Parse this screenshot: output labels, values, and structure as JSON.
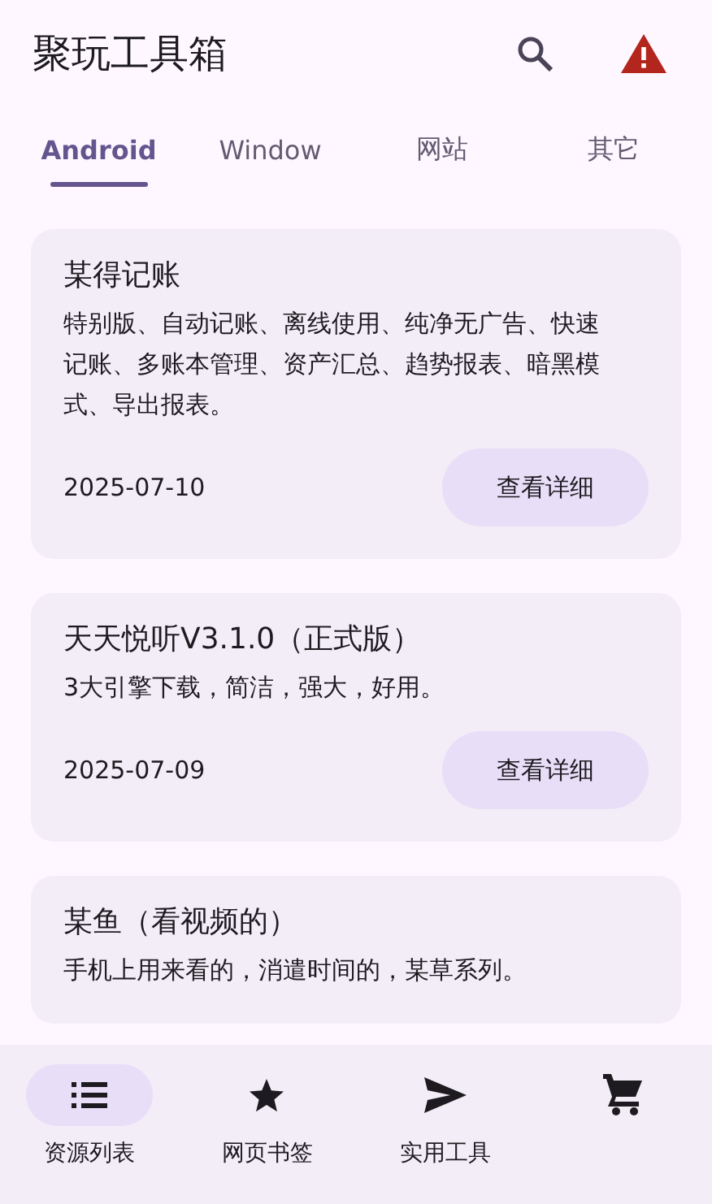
{
  "app_bar": {
    "title": "聚玩工具箱"
  },
  "tabs": [
    {
      "label": "Android",
      "selected": true
    },
    {
      "label": "Window",
      "selected": false
    },
    {
      "label": "网站",
      "selected": false
    },
    {
      "label": "其它",
      "selected": false
    }
  ],
  "cards": [
    {
      "title": "某得记账",
      "description": "特别版、自动记账、离线使用、纯净无广告、快速记账、多账本管理、资产汇总、趋势报表、暗黑模式、导出报表。",
      "date": "2025-07-10",
      "button": "查看详细"
    },
    {
      "title": "天天悦听V3.1.0（正式版）",
      "description": "3大引擎下载，简洁，强大，好用。",
      "date": "2025-07-09",
      "button": "查看详细"
    },
    {
      "title": "某鱼（看视频的）",
      "description": "手机上用来看的，消遣时间的，某草系列。"
    }
  ],
  "bottom_nav": [
    {
      "kind": "list",
      "label": "资源列表",
      "selected": true
    },
    {
      "kind": "star",
      "label": "网页书签",
      "selected": false
    },
    {
      "kind": "send",
      "label": "实用工具",
      "selected": false
    },
    {
      "kind": "cart",
      "selected": false
    }
  ]
}
